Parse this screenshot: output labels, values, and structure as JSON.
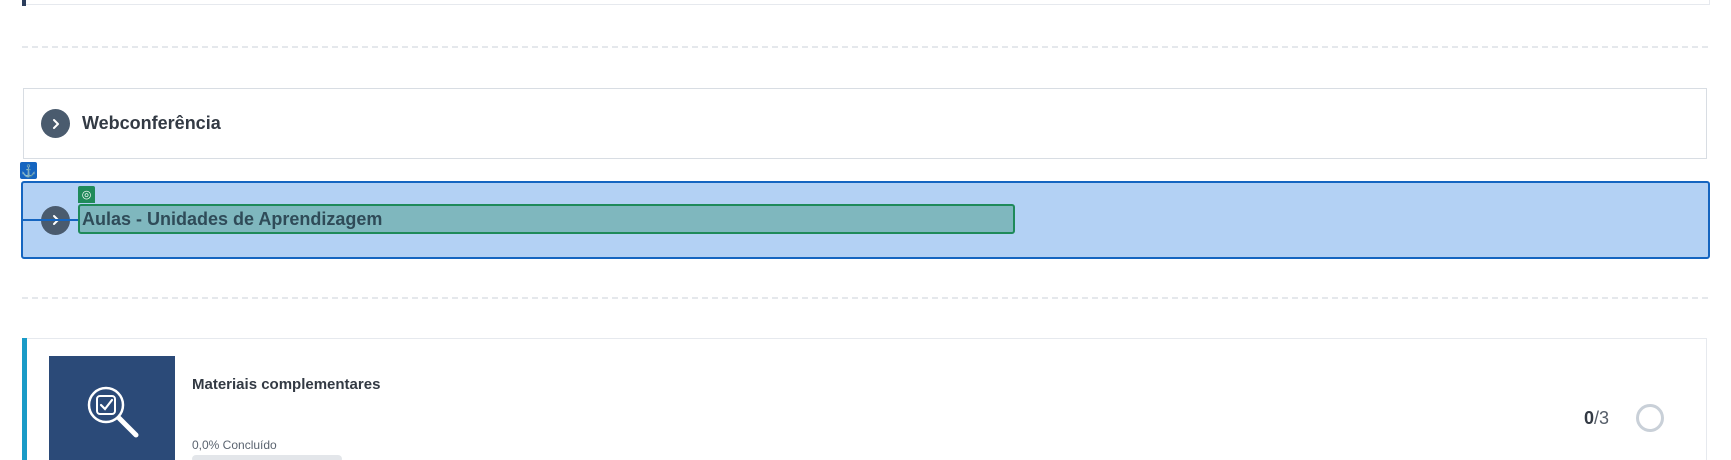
{
  "sections": [
    {
      "title": "Webconferência"
    },
    {
      "title": "Aulas - Unidades de Aprendizagem"
    }
  ],
  "activity": {
    "title": "Materiais complementares",
    "progress_label": "0,0% Concluído",
    "progress": 0.0,
    "done": "0",
    "total": "/3",
    "thumb_icon": "search-check-icon"
  },
  "icons": {
    "chevron": "chevron-right-icon",
    "anchor": "anchor-icon",
    "target": "target-icon"
  },
  "colors": {
    "selected_bg": "#b3d1f4",
    "selected_border": "#1565c0",
    "target_bg": "#7fb7be",
    "target_border": "#1f8a5a",
    "thumb_bg": "#2b4a78",
    "accent": "#1a9bc7"
  }
}
